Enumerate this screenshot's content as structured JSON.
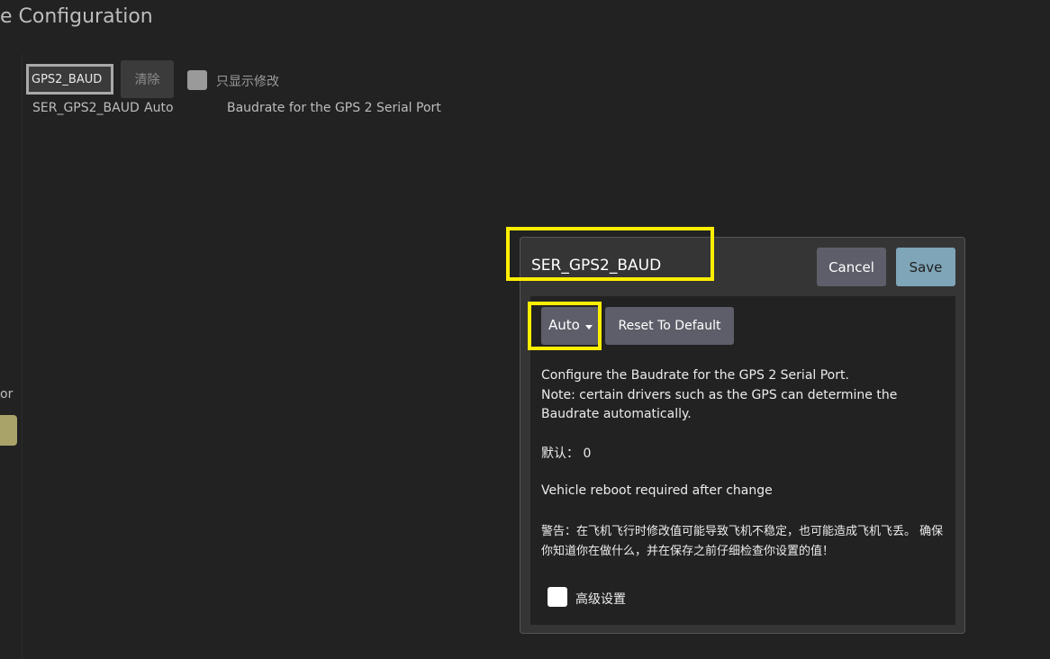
{
  "header": {
    "page_title": "e Configuration"
  },
  "left_panel": {
    "cut_text": "or"
  },
  "search": {
    "value": "GPS2_BAUD",
    "clear_label": "清除",
    "show_changed_label": "只显示修改"
  },
  "param_list": [
    {
      "name": "SER_GPS2_BAUD",
      "value": "Auto",
      "description": "Baudrate for the GPS 2 Serial Port"
    }
  ],
  "dialog": {
    "title": "SER_GPS2_BAUD",
    "cancel_label": "Cancel",
    "save_label": "Save",
    "value_selected": "Auto",
    "reset_label": "Reset To Default",
    "description_line1": "Configure the Baudrate for the GPS 2 Serial Port.",
    "description_line2": "Note: certain drivers such as the GPS can determine the Baudrate automatically.",
    "default_text": "默认： 0",
    "reboot_text": "Vehicle reboot required after change",
    "warning_text": "警告：在飞机飞行时修改值可能导致飞机不稳定，也可能造成飞机飞丢。 确保你知道你在做什么，并在保存之前仔细检查你设置的值！",
    "advanced_label": "高级设置"
  },
  "colors": {
    "background": "#222222",
    "dialog_background": "#353535",
    "button_gray": "#5e5e6a",
    "save_button": "#7fa5b8",
    "highlight": "#ffee00"
  }
}
